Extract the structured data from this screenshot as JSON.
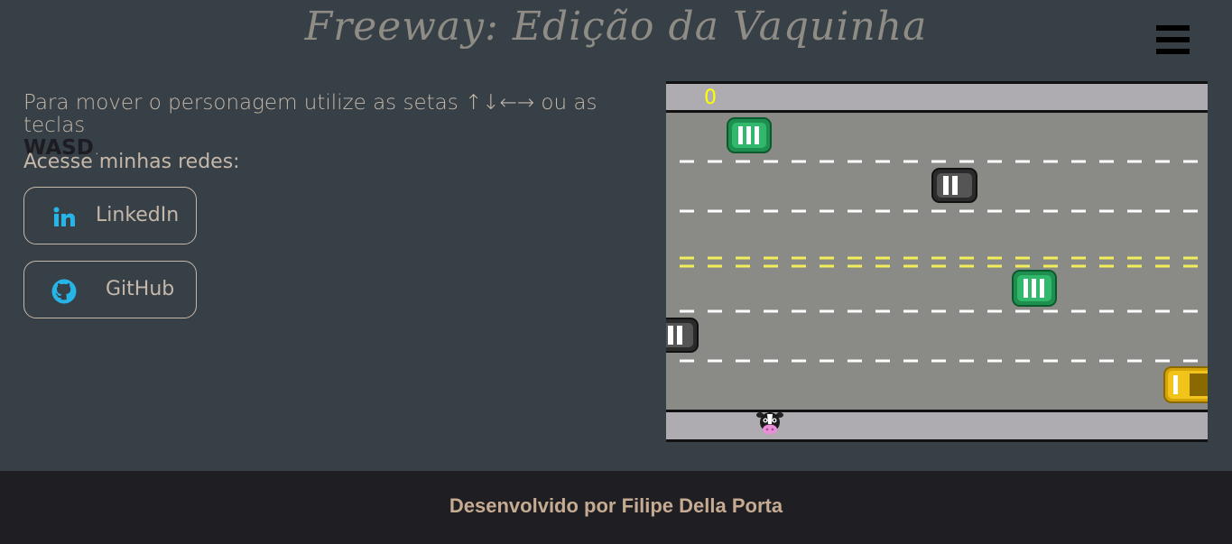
{
  "header": {
    "title": "Freeway: Edição da Vaquinha",
    "menu_icon": "hamburger-menu-icon"
  },
  "instructions": {
    "text_before": "Para mover o personagem utilize as setas ",
    "arrows": "↑↓←→",
    "text_after": " ou as teclas",
    "keys": "WASD",
    "period": "."
  },
  "social": {
    "heading": "Acesse minhas redes:",
    "linkedin": {
      "label": "LinkedIn",
      "icon": "linkedin-icon"
    },
    "github": {
      "label": "GitHub",
      "icon": "github-icon"
    }
  },
  "game": {
    "score": "0",
    "colors": {
      "road": "#8a8b86",
      "sidewalk": "#aeacb1",
      "lane_line": "#ffffff",
      "center_line": "#f2ee5a",
      "score": "#ffff00"
    },
    "cars": [
      {
        "color": "green",
        "lane": 1
      },
      {
        "color": "dark-gray",
        "lane": 2
      },
      {
        "color": "green",
        "lane": 4
      },
      {
        "color": "dark-gray",
        "lane": 5
      },
      {
        "color": "yellow",
        "lane": 6
      }
    ],
    "player": "cow"
  },
  "footer": {
    "text": "Desenvolvido por Filipe Della Porta"
  }
}
